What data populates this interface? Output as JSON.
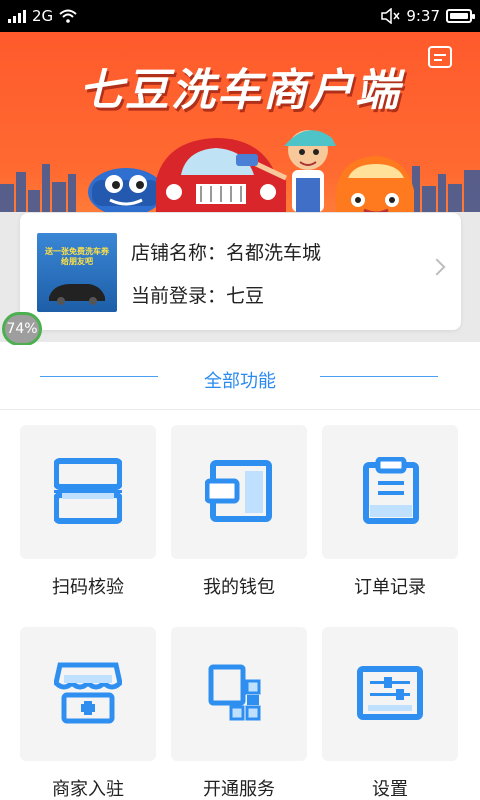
{
  "status_bar": {
    "network": "2G",
    "time": "9:37"
  },
  "header": {
    "title": "七豆洗车商户端"
  },
  "shop": {
    "thumbnail_text": "送一张免费洗车券 给朋友吧",
    "name_line": "店铺名称：名都洗车城",
    "login_line": "当前登录：七豆"
  },
  "progress_bubble": "74%",
  "section": {
    "title": "全部功能"
  },
  "features": [
    {
      "label": "扫码核验",
      "icon": "scan-icon"
    },
    {
      "label": "我的钱包",
      "icon": "wallet-icon"
    },
    {
      "label": "订单记录",
      "icon": "clipboard-icon"
    },
    {
      "label": "商家入驻",
      "icon": "storefront-icon"
    },
    {
      "label": "开通服务",
      "icon": "blocks-icon"
    },
    {
      "label": "设置",
      "icon": "sliders-icon"
    }
  ],
  "colors": {
    "accent": "#2b8af0",
    "icon_blue": "#2e8ff0",
    "hero_orange": "#ff5a2c"
  }
}
